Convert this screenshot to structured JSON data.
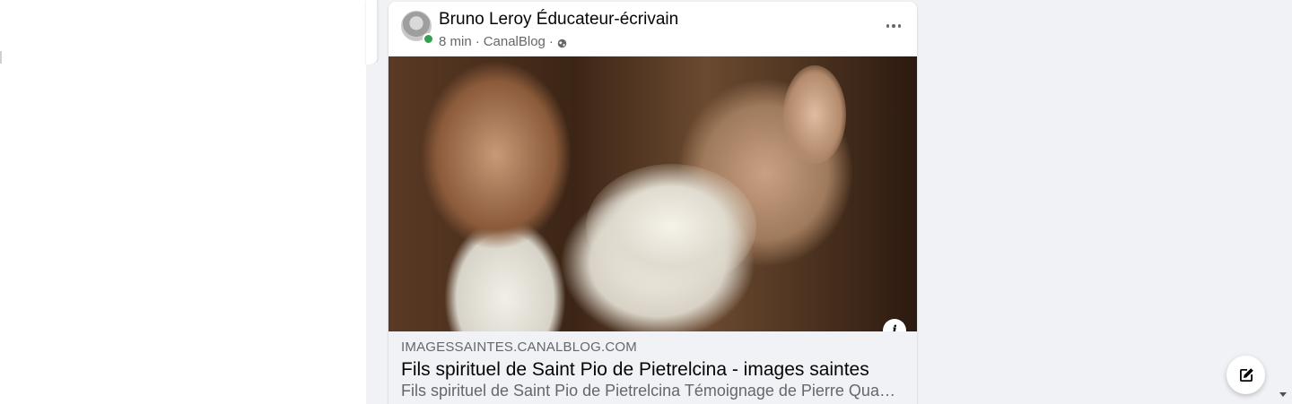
{
  "post": {
    "author": "Bruno Leroy Éducateur-écrivain",
    "time": "8 min",
    "separator": "·",
    "source": "CanalBlog",
    "audience_icon": "globe-icon",
    "more_icon": "more-options-icon",
    "online_color": "#31a24c"
  },
  "link": {
    "domain": "IMAGESSAINTES.CANALBLOG.COM",
    "title": "Fils spirituel de Saint Pio de Pietrelcina - images saintes",
    "description": "Fils spirituel de Saint Pio de Pietrelcina Témoignage de Pierre Quantin…",
    "info_icon_glyph": "i"
  },
  "compose": {
    "icon": "compose-icon"
  },
  "colors": {
    "page_bg": "#f0f2f5",
    "card_bg": "#ffffff",
    "text_primary": "#050505",
    "text_secondary": "#65676b"
  }
}
